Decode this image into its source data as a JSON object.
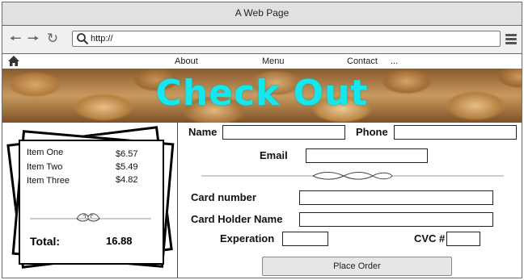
{
  "browser": {
    "window_title": "A Web Page",
    "address": "http://",
    "back_icon": "arrow-left-icon",
    "forward_icon": "arrow-right-icon",
    "reload_icon": "reload-icon",
    "menu_icon": "hamburger-icon"
  },
  "nav": {
    "home_icon": "home-icon",
    "links": [
      "About",
      "Menu",
      "Contact",
      "..."
    ]
  },
  "banner": {
    "title": "Check Out"
  },
  "cart": {
    "items": [
      {
        "name": "Item One",
        "price": "$6.57"
      },
      {
        "name": "Item Two",
        "price": "$5.49"
      },
      {
        "name": "Item Three",
        "price": "$4.82"
      }
    ],
    "total_label": "Total:",
    "total_value": "16.88"
  },
  "form": {
    "name_label": "Name",
    "phone_label": "Phone",
    "email_label": "Email",
    "card_number_label": "Card number",
    "card_holder_label": "Card Holder Name",
    "expiration_label": "Experation",
    "cvc_label": "CVC #",
    "submit_label": "Place Order"
  },
  "colors": {
    "title_cyan": "#16e6ee",
    "chrome_gray": "#e1e1e1"
  }
}
